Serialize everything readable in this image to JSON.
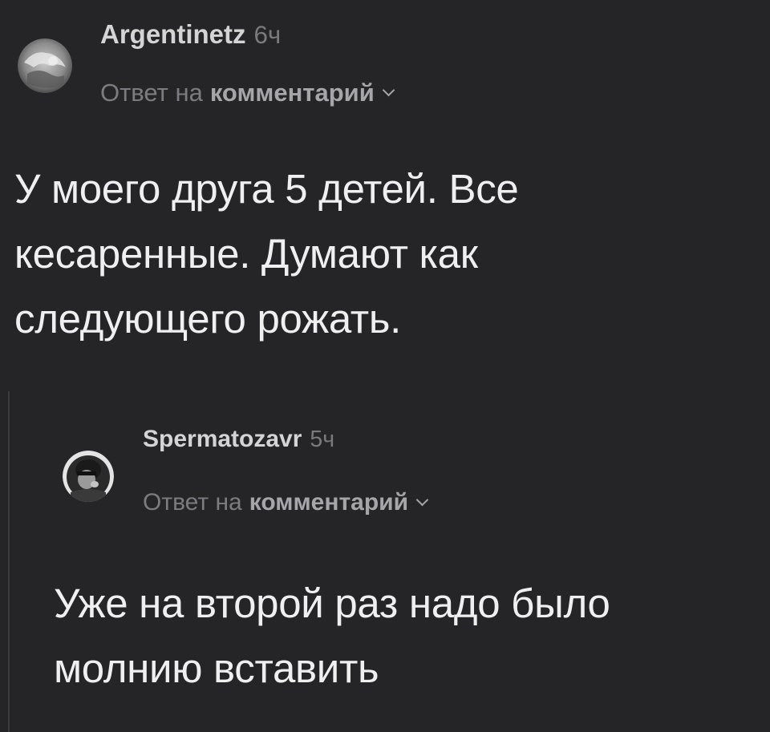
{
  "comments": [
    {
      "author": "Argentinetz",
      "time": "6ч",
      "reply_prefix": "Ответ на",
      "reply_target": "комментарий",
      "lines": [
        "У моего друга 5 детей. Все",
        "кесаренные. Думают как",
        "следующего рожать."
      ]
    },
    {
      "author": "Spermatozavr",
      "time": "5ч",
      "reply_prefix": "Ответ на",
      "reply_target": "комментарий",
      "lines": [
        "Уже на второй раз надо было",
        "молнию вставить"
      ]
    }
  ],
  "icons": {
    "avatar_1": "avatar",
    "avatar_2": "avatar",
    "chevron": "chevron-down-icon"
  },
  "colors": {
    "background": "#252528",
    "text": "#efefef",
    "muted": "#7c7c80"
  }
}
